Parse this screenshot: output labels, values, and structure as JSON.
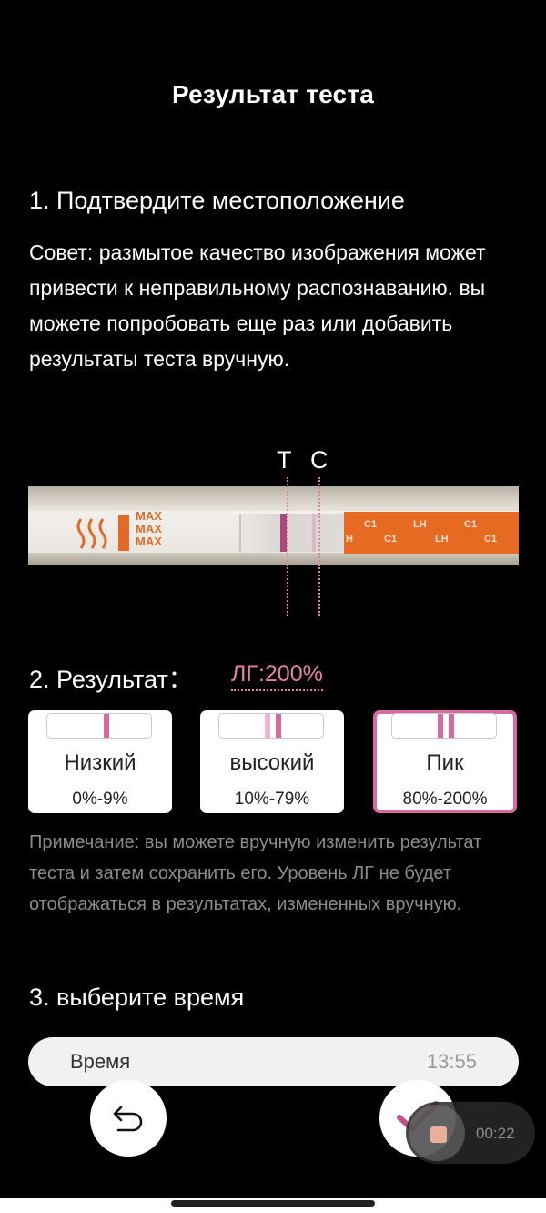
{
  "header": {
    "title": "Результат теста"
  },
  "location_section": {
    "heading": "1. Подтвердите местоположение",
    "tip": "Совет: размытое качество изображения может привести к неправильному распознаванию. вы можете попробовать еще раз или добавить результаты теста вручную.",
    "markers": {
      "test": "T",
      "control": "C"
    },
    "strip_text": {
      "max": [
        "MAX",
        "MAX",
        "MAX"
      ],
      "lh": [
        "C1",
        "LH",
        "C1",
        "H",
        "C1",
        "LH",
        "C1"
      ]
    }
  },
  "result_section": {
    "label": "2. Результат：",
    "value": "ЛГ:200%",
    "options": [
      {
        "label": "Низкий",
        "range": "0%-9%",
        "selected": false
      },
      {
        "label": "высокий",
        "range": "10%-79%",
        "selected": false
      },
      {
        "label": "Пик",
        "range": "80%-200%",
        "selected": true
      }
    ],
    "note": "Примечание: вы можете вручную изменить результат теста и затем сохранить его. Уровень ЛГ не будет отображаться в результатах, измененных вручную."
  },
  "time_section": {
    "heading": "3. выберите время",
    "field_label": "Время",
    "field_value": "13:55"
  },
  "actions": {
    "undo_icon": "undo-icon",
    "confirm_icon": "checkmark-icon"
  },
  "recorder": {
    "elapsed": "00:22"
  },
  "colors": {
    "accent": "#d86a9f",
    "accent_text": "#e57fb0",
    "strip_orange": "#e76a22"
  }
}
